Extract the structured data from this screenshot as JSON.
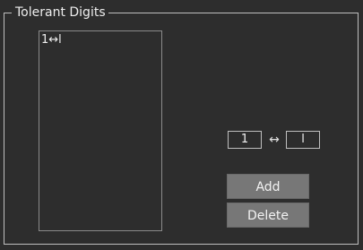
{
  "groupbox": {
    "title": "Tolerant Digits"
  },
  "list": {
    "items": [
      {
        "label": "1↔l"
      }
    ]
  },
  "pair": {
    "left_value": "1",
    "arrow": "↔",
    "right_value": "l"
  },
  "buttons": {
    "add_label": "Add",
    "delete_label": "Delete"
  },
  "colors": {
    "background": "#2d2d2d",
    "border": "#bfbfbf",
    "button": "#777777",
    "text": "#f2f2f2"
  }
}
